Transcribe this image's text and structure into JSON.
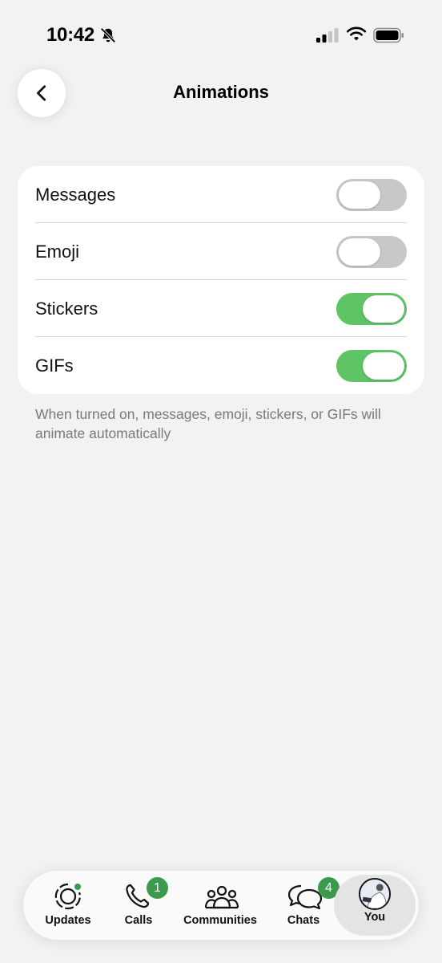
{
  "status_bar": {
    "time": "10:42",
    "icons": [
      "bell-slash-icon",
      "signal-icon",
      "wifi-icon",
      "battery-icon"
    ]
  },
  "header": {
    "title": "Animations",
    "back_icon": "chevron-left-icon"
  },
  "settings": [
    {
      "label": "Messages",
      "enabled": false
    },
    {
      "label": "Emoji",
      "enabled": false
    },
    {
      "label": "Stickers",
      "enabled": true
    },
    {
      "label": "GIFs",
      "enabled": true
    }
  ],
  "footer_note": "When turned on, messages, emoji, stickers, or GIFs will animate automatically",
  "tab_bar": {
    "updates": {
      "label": "Updates",
      "icon": "updates-icon"
    },
    "calls": {
      "label": "Calls",
      "icon": "phone-icon",
      "badge": "1"
    },
    "communities": {
      "label": "Communities",
      "icon": "communities-icon"
    },
    "chats": {
      "label": "Chats",
      "icon": "chats-icon",
      "badge": "4"
    },
    "you": {
      "label": "You",
      "icon": "avatar",
      "selected": true
    }
  },
  "colors": {
    "background": "#f2f2f2",
    "toggle_on": "#5fc466",
    "toggle_off": "#c8c8ca",
    "badge": "#3c9a4b"
  }
}
